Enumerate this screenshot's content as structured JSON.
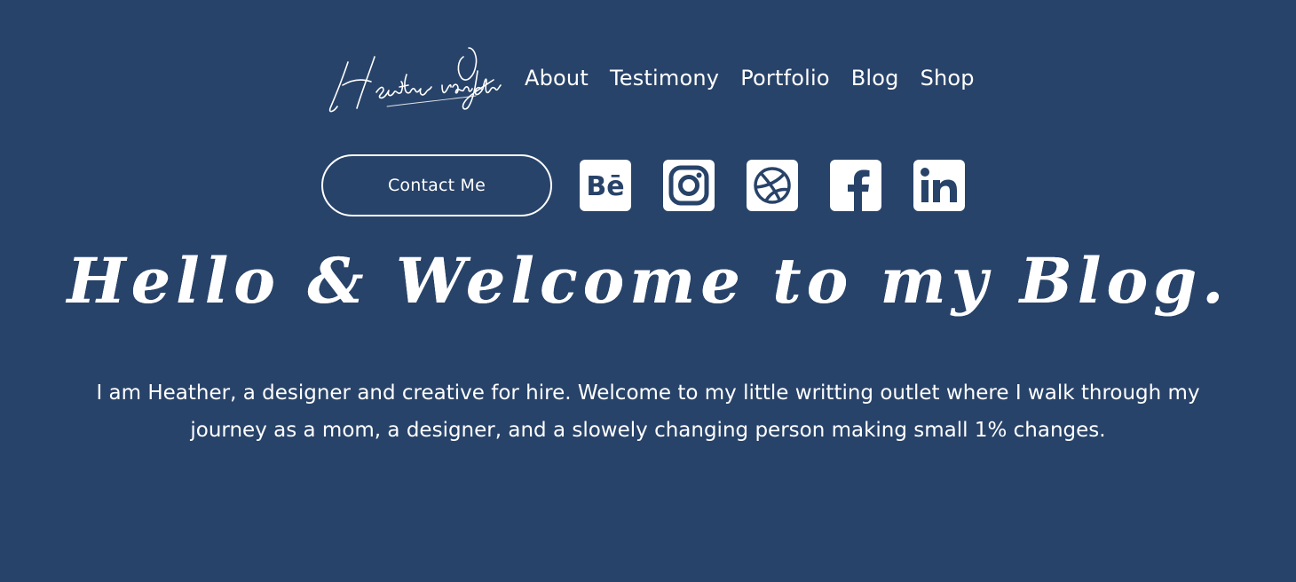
{
  "theme": {
    "background": "#284369",
    "foreground": "#ffffff"
  },
  "logo": {
    "text": "Heather van der Uys",
    "icon": "signature-logo"
  },
  "nav": {
    "items": [
      {
        "label": "About"
      },
      {
        "label": "Testimony"
      },
      {
        "label": "Portfolio"
      },
      {
        "label": "Blog"
      },
      {
        "label": "Shop"
      }
    ]
  },
  "cta": {
    "contact_label": "Contact Me"
  },
  "social": [
    {
      "name": "behance",
      "icon": "behance-icon"
    },
    {
      "name": "instagram",
      "icon": "instagram-icon"
    },
    {
      "name": "dribbble",
      "icon": "dribbble-icon"
    },
    {
      "name": "facebook",
      "icon": "facebook-icon"
    },
    {
      "name": "linkedin",
      "icon": "linkedin-icon"
    }
  ],
  "hero": {
    "title": "Hello & Welcome to my Blog.",
    "intro": "I am Heather, a designer and creative for hire. Welcome to my little writting outlet where I walk through my journey as a mom, a designer, and a slowely changing person making small 1% changes."
  }
}
